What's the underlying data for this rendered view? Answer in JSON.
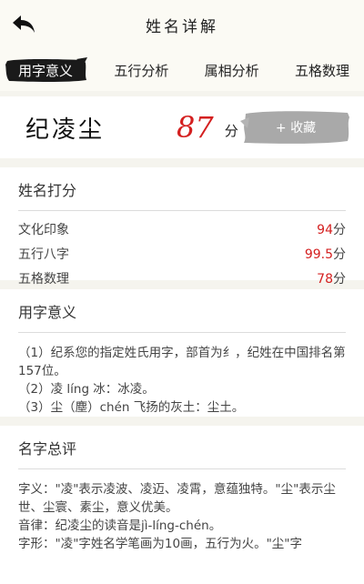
{
  "header": {
    "title": "姓名详解",
    "back_icon": "back-arrow-icon"
  },
  "tabs": [
    {
      "label": "用字意义",
      "active": true
    },
    {
      "label": "五行分析",
      "active": false
    },
    {
      "label": "属相分析",
      "active": false
    },
    {
      "label": "五格数理",
      "active": false
    }
  ],
  "score_card": {
    "name": "纪凌尘",
    "score": "87",
    "unit": "分",
    "favorite_label": "+ 收藏"
  },
  "name_score": {
    "title": "姓名打分",
    "rows": [
      {
        "label": "文化印象",
        "value": "94",
        "unit": "分"
      },
      {
        "label": "五行八字",
        "value": "99.5",
        "unit": "分"
      },
      {
        "label": "五格数理",
        "value": "78",
        "unit": "分"
      }
    ]
  },
  "char_meaning": {
    "title": "用字意义",
    "lines": [
      "（1）纪系您的指定姓氏用字，部首为纟，纪姓在中国排名第157位。",
      "（2）凌 líng 冰：冰凌。",
      "（3）尘（塵）chén 飞扬的灰土：尘土。"
    ]
  },
  "summary": {
    "title": "名字总评",
    "lines": [
      "字义：\"凌\"表示凌波、凌迈、凌霄，意蕴独特。\"尘\"表示尘世、尘寰、素尘，意义优美。",
      "音律：纪凌尘的读音是jì-líng-chén。",
      "字形：\"凌\"字姓名学笔画为10画，五行为火。\"尘\"字"
    ]
  },
  "colors": {
    "accent_red": "#d42020",
    "brush_dark": "#1a1a1a",
    "brush_gray": "#a9a9a9",
    "background": "#f5f4ee"
  }
}
